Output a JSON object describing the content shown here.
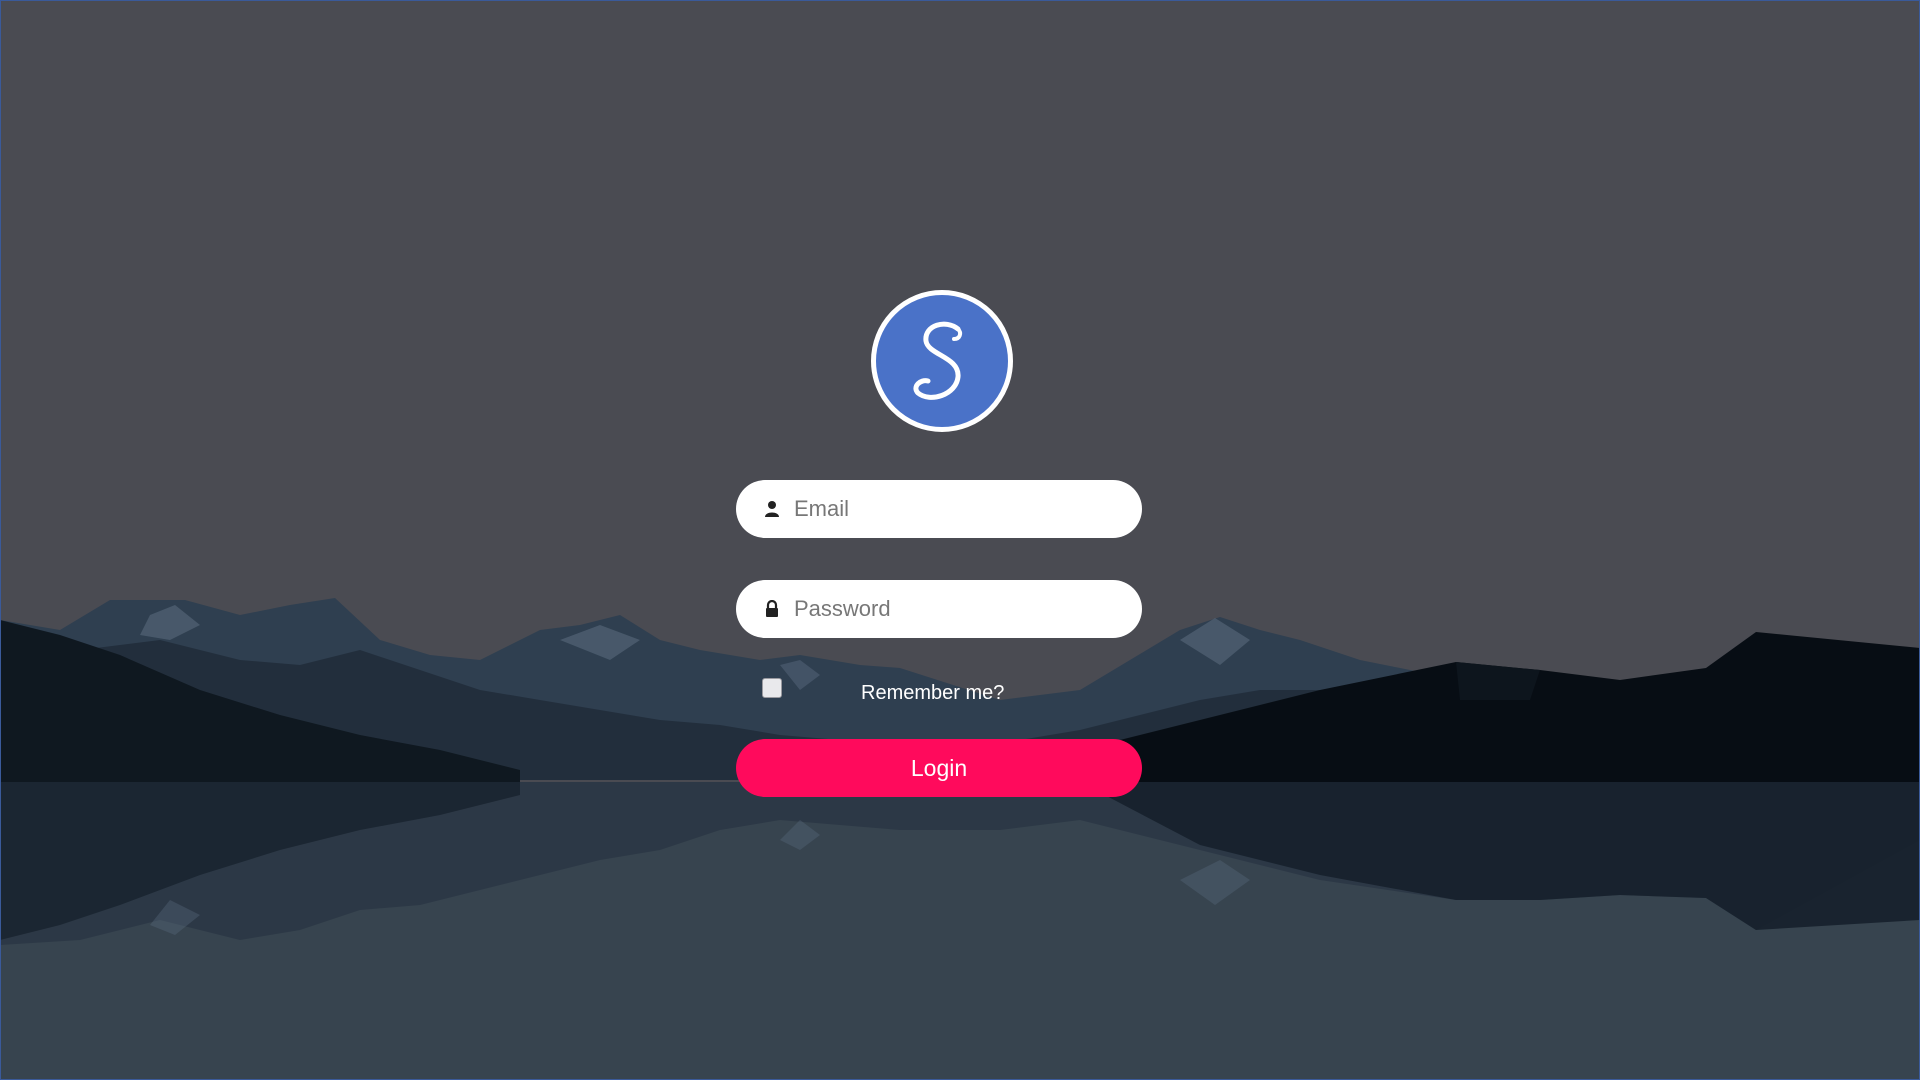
{
  "logo": {
    "letter": "S",
    "background_color": "#4a72c8",
    "border_color": "#ffffff"
  },
  "form": {
    "email": {
      "placeholder": "Email",
      "value": "",
      "icon": "user-icon"
    },
    "password": {
      "placeholder": "Password",
      "value": "",
      "icon": "lock-icon"
    },
    "remember": {
      "label": "Remember me?",
      "checked": false
    },
    "submit_label": "Login"
  },
  "colors": {
    "background": "#4a4b52",
    "accent": "#ff0a5c",
    "field_background": "#ffffff",
    "water": "#37444f"
  }
}
